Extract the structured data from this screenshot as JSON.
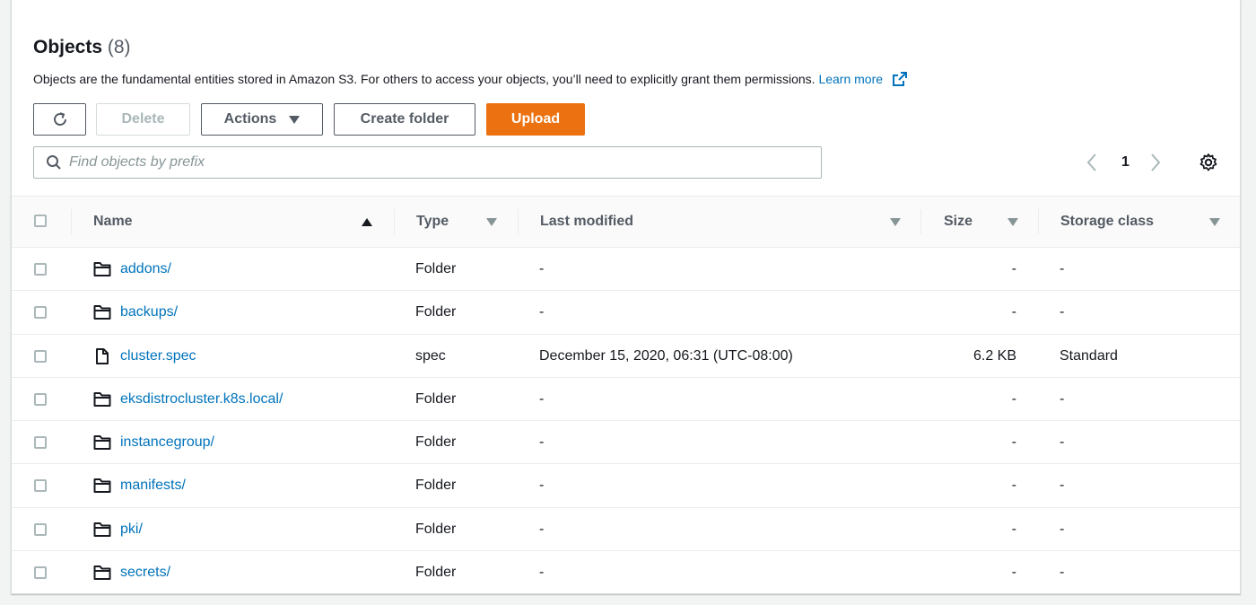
{
  "header": {
    "title": "Objects",
    "count": "(8)",
    "description": "Objects are the fundamental entities stored in Amazon S3. For others to access your objects, you’ll need to explicitly grant them permissions.",
    "learn_more": "Learn more"
  },
  "toolbar": {
    "refresh_icon": "refresh-icon",
    "delete_label": "Delete",
    "actions_label": "Actions",
    "create_folder_label": "Create folder",
    "upload_label": "Upload"
  },
  "search": {
    "placeholder": "Find objects by prefix"
  },
  "pagination": {
    "current_page": "1"
  },
  "table": {
    "columns": [
      "Name",
      "Type",
      "Last modified",
      "Size",
      "Storage class"
    ],
    "rows": [
      {
        "name": "addons/",
        "icon": "folder-icon",
        "type": "Folder",
        "last_modified": "-",
        "size": "-",
        "storage_class": "-"
      },
      {
        "name": "backups/",
        "icon": "folder-icon",
        "type": "Folder",
        "last_modified": "-",
        "size": "-",
        "storage_class": "-"
      },
      {
        "name": "cluster.spec",
        "icon": "file-icon",
        "type": "spec",
        "last_modified": "December 15, 2020, 06:31 (UTC-08:00)",
        "size": "6.2 KB",
        "storage_class": "Standard"
      },
      {
        "name": "eksdistrocluster.k8s.local/",
        "icon": "folder-icon",
        "type": "Folder",
        "last_modified": "-",
        "size": "-",
        "storage_class": "-"
      },
      {
        "name": "instancegroup/",
        "icon": "folder-icon",
        "type": "Folder",
        "last_modified": "-",
        "size": "-",
        "storage_class": "-"
      },
      {
        "name": "manifests/",
        "icon": "folder-icon",
        "type": "Folder",
        "last_modified": "-",
        "size": "-",
        "storage_class": "-"
      },
      {
        "name": "pki/",
        "icon": "folder-icon",
        "type": "Folder",
        "last_modified": "-",
        "size": "-",
        "storage_class": "-"
      },
      {
        "name": "secrets/",
        "icon": "folder-icon",
        "type": "Folder",
        "last_modified": "-",
        "size": "-",
        "storage_class": "-"
      }
    ]
  },
  "colors": {
    "accent": "#ec7211",
    "link": "#0073bb",
    "text": "#16191f",
    "muted": "#545b64"
  }
}
